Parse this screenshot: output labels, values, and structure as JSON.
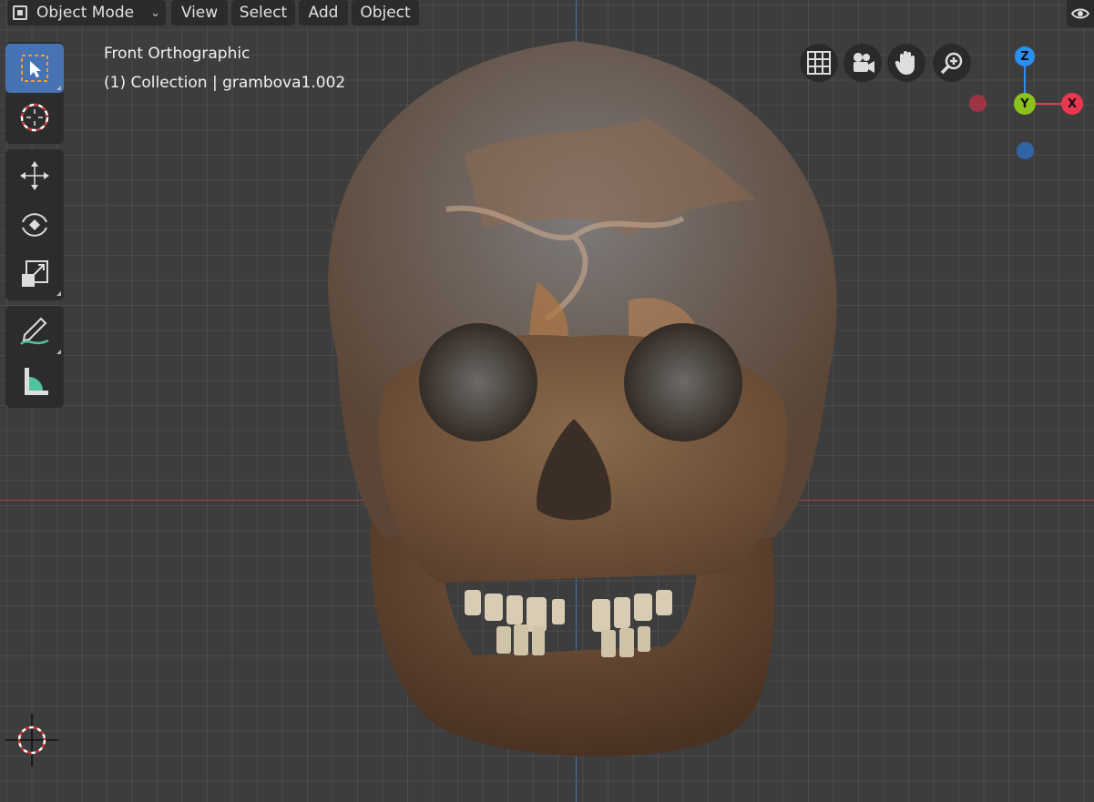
{
  "header": {
    "mode_label": "Object Mode",
    "menus": [
      "View",
      "Select",
      "Add",
      "Object"
    ]
  },
  "viewport": {
    "view_name": "Front Orthographic",
    "collection_info": "(1) Collection | grambova1.002"
  },
  "gizmo": {
    "z_label": "Z",
    "y_label": "Y",
    "x_label": "X",
    "x_color": "#e8384f",
    "y_color": "#8bc11a",
    "z_color": "#2b8ff0"
  },
  "colors": {
    "background": "#3d3d3d",
    "active_tool": "#4772b3",
    "x_axis_line": "#a5424d",
    "z_axis_line": "#3c6fb0"
  },
  "tools": [
    "select-box",
    "cursor",
    "move",
    "rotate",
    "scale",
    "annotate",
    "measure"
  ],
  "nav_buttons": [
    "grid-icon",
    "camera-icon",
    "hand-icon",
    "zoom-icon"
  ]
}
